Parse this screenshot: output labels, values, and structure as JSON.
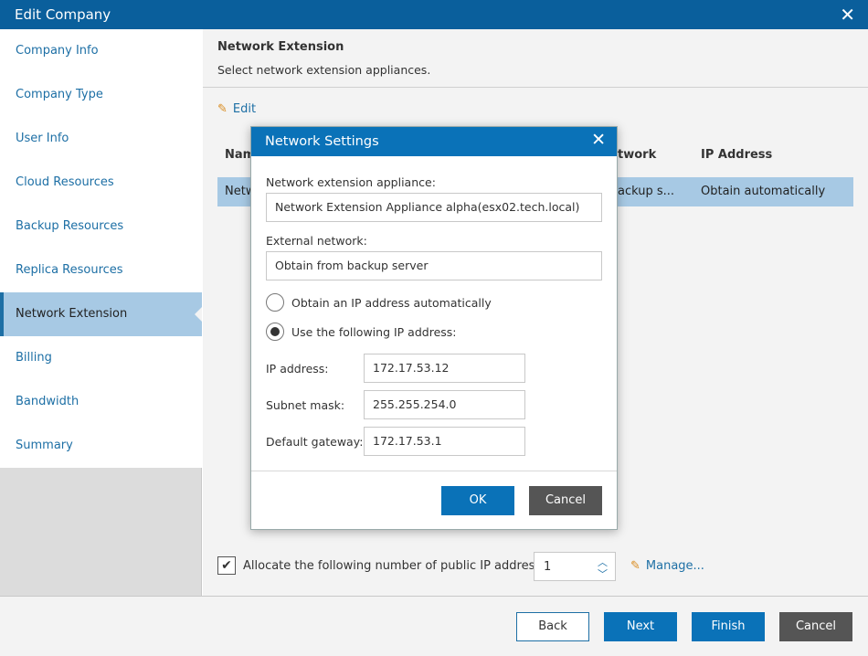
{
  "window": {
    "title": "Edit Company"
  },
  "sidebar": {
    "items": [
      {
        "label": "Company Info"
      },
      {
        "label": "Company Type"
      },
      {
        "label": "User Info"
      },
      {
        "label": "Cloud Resources"
      },
      {
        "label": "Backup Resources"
      },
      {
        "label": "Replica Resources"
      },
      {
        "label": "Network Extension"
      },
      {
        "label": "Billing"
      },
      {
        "label": "Bandwidth"
      },
      {
        "label": "Summary"
      }
    ],
    "active_index": 6
  },
  "main": {
    "title": "Network Extension",
    "subtitle": "Select network extension appliances.",
    "edit_label": "Edit",
    "grid": {
      "columns": [
        "Nam",
        "twork",
        "IP Address"
      ],
      "row": [
        "Netw",
        "ackup s...",
        "Obtain automatically"
      ]
    },
    "allocate_label": "Allocate the following number of public IP addresses",
    "allocate_checked": true,
    "allocate_value": "1",
    "manage_label": "Manage..."
  },
  "modal": {
    "title": "Network Settings",
    "appliance_label": "Network extension appliance:",
    "appliance_value": "Network Extension Appliance alpha(esx02.tech.local)",
    "external_label": "External network:",
    "external_value": "Obtain from backup server",
    "radio_auto": "Obtain an IP address automatically",
    "radio_manual": "Use the following IP address:",
    "radio_selected": "manual",
    "ip_label": "IP address:",
    "ip_value": "172.17.53.12",
    "mask_label": "Subnet mask:",
    "mask_value": "255.255.254.0",
    "gateway_label": "Default gateway:",
    "gateway_value": "172.17.53.1",
    "ok_label": "OK",
    "cancel_label": "Cancel"
  },
  "footer": {
    "back_label": "Back",
    "next_label": "Next",
    "finish_label": "Finish",
    "cancel_label": "Cancel"
  },
  "icons": {
    "close": "close-icon",
    "pencil": "pencil-icon",
    "check": "checkmark-icon",
    "spinner_up": "chevron-up-icon",
    "spinner_down": "chevron-down-icon"
  },
  "colors": {
    "titlebar": "#0a5f9c",
    "accent": "#0a72b8",
    "link": "#1d6fa5",
    "selection": "#a7c9e4"
  }
}
